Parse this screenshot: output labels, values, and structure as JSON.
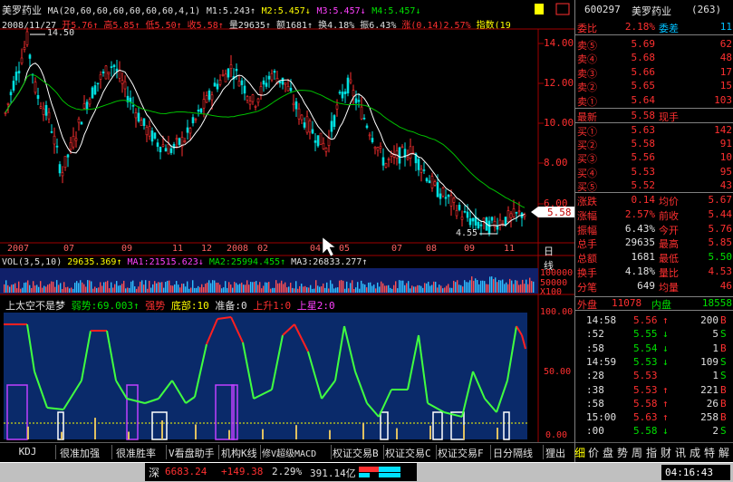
{
  "header": {
    "stock_name": "美罗药业",
    "ma_formula": "MA(20,60,60,60,60,60,60,4,1)",
    "m1": "M1:5.243↑",
    "m2": "M2:5.457↓",
    "m3": "M3:5.457↓",
    "m4": "M4:5.457↓",
    "date": "2008/11/27",
    "open": "开5.76↑",
    "high": "高5.85↑",
    "low": "低5.50↑",
    "close": "收5.58↑",
    "volume": "量29635↑",
    "amount": "额1681↑",
    "turnover": "换4.18%",
    "amplitude": "振6.43%",
    "change": "涨(0.14)2.57%",
    "index": "指数(19"
  },
  "price_chart": {
    "y_ticks": [
      "14.00",
      "12.00",
      "10.00",
      "8.00",
      "6.00"
    ],
    "high_label": "14.50",
    "low_label": "4.55",
    "current_price_tag": "5.58"
  },
  "x_axis": {
    "labels": [
      "2007",
      "07",
      "09",
      "11",
      "12",
      "2008",
      "02",
      "04",
      "05",
      "07",
      "08",
      "09",
      "11"
    ],
    "period_label": "日线"
  },
  "volume_header": {
    "vol": "VOL(3,5,10)",
    "vol_val": "29635.369↑",
    "ma1": "MA1:21515.623↓",
    "ma2": "MA2:25994.455↑",
    "ma3": "MA3:26833.277↑",
    "y_ticks": [
      "100000",
      "50000",
      "X100"
    ]
  },
  "indicator": {
    "title": "上太空不是梦",
    "weak": "弱势:69.003↑",
    "strong": "强势",
    "bottom": "底部:10",
    "prepare": "准备:0",
    "up1": "上升1:0",
    "star2": "上星2:0",
    "y_ticks": [
      "100.00",
      "50.00",
      "0.00"
    ]
  },
  "tabs": [
    "KDJ",
    "很准加强",
    "很准胜率",
    "V看盘助手",
    "机构K线",
    "修V超级MACD",
    "权证交易B",
    "权证交易C",
    "权证交易F",
    "日分隔线",
    "狸出"
  ],
  "quote": {
    "code": "600297",
    "name": "美罗药业",
    "num": "(263)",
    "webi_label": "委比",
    "webi_val": "2.18%",
    "weicha_label": "委差",
    "weicha_val": "11",
    "sells": [
      {
        "label": "卖⑤",
        "price": "5.69",
        "vol": "62"
      },
      {
        "label": "卖④",
        "price": "5.68",
        "vol": "48"
      },
      {
        "label": "卖③",
        "price": "5.66",
        "vol": "17"
      },
      {
        "label": "卖②",
        "price": "5.65",
        "vol": "15"
      },
      {
        "label": "卖①",
        "price": "5.64",
        "vol": "103"
      }
    ],
    "latest_label": "最新",
    "latest_val": "5.58",
    "now_hand_label": "现手",
    "buys": [
      {
        "label": "买①",
        "price": "5.63",
        "vol": "142"
      },
      {
        "label": "买②",
        "price": "5.58",
        "vol": "91"
      },
      {
        "label": "买③",
        "price": "5.56",
        "vol": "10"
      },
      {
        "label": "买④",
        "price": "5.53",
        "vol": "95"
      },
      {
        "label": "买⑤",
        "price": "5.52",
        "vol": "43"
      }
    ],
    "stats": [
      {
        "l1": "涨跌",
        "v1": "0.14",
        "l2": "均价",
        "v2": "5.67"
      },
      {
        "l1": "涨幅",
        "v1": "2.57%",
        "l2": "前收",
        "v2": "5.44"
      },
      {
        "l1": "振幅",
        "v1": "6.43%",
        "l2": "今开",
        "v2": "5.76"
      },
      {
        "l1": "总手",
        "v1": "29635",
        "l2": "最高",
        "v2": "5.85"
      },
      {
        "l1": "总额",
        "v1": "1681",
        "l2": "最低",
        "v2": "5.50"
      },
      {
        "l1": "换手",
        "v1": "4.18%",
        "l2": "量比",
        "v2": "4.53"
      },
      {
        "l1": "分笔",
        "v1": "649",
        "l2": "均量",
        "v2": "46"
      }
    ],
    "outer_label": "外盘",
    "outer_val": "11078",
    "inner_label": "内盘",
    "inner_val": "18558"
  },
  "ticks": [
    {
      "time": "14:58",
      "price": "5.56",
      "arrow": "↑",
      "vol": "200",
      "side": "B"
    },
    {
      "time": ":52",
      "price": "5.55",
      "arrow": "↓",
      "vol": "5",
      "side": "S"
    },
    {
      "time": ":58",
      "price": "5.54",
      "arrow": "↓",
      "vol": "1",
      "side": "B"
    },
    {
      "time": "14:59",
      "price": "5.53",
      "arrow": "↓",
      "vol": "109",
      "side": "S"
    },
    {
      "time": ":28",
      "price": "5.53",
      "arrow": "",
      "vol": "1",
      "side": "S"
    },
    {
      "time": ":38",
      "price": "5.53",
      "arrow": "↑",
      "vol": "221",
      "side": "B"
    },
    {
      "time": ":58",
      "price": "5.58",
      "arrow": "↑",
      "vol": "26",
      "side": "B"
    },
    {
      "time": "15:00",
      "price": "5.63",
      "arrow": "↑",
      "vol": "258",
      "side": "B"
    },
    {
      "time": ":00",
      "price": "5.58",
      "arrow": "↓",
      "vol": "2",
      "side": "S"
    }
  ],
  "side_tabs": [
    "细",
    "价",
    "盘",
    "势",
    "周",
    "指",
    "财",
    "讯",
    "成",
    "特",
    "解"
  ],
  "status": {
    "market": "深",
    "index": "6683.24",
    "change": "+149.38",
    "pct": "2.29%",
    "amount": "391.14亿",
    "time": "04:16:43"
  },
  "colors": {
    "up": "#ff3030",
    "down": "#00e000",
    "indicator_bg": "#0a2a6a",
    "ma_white": "#ffffff",
    "ma_green": "#00c000"
  }
}
